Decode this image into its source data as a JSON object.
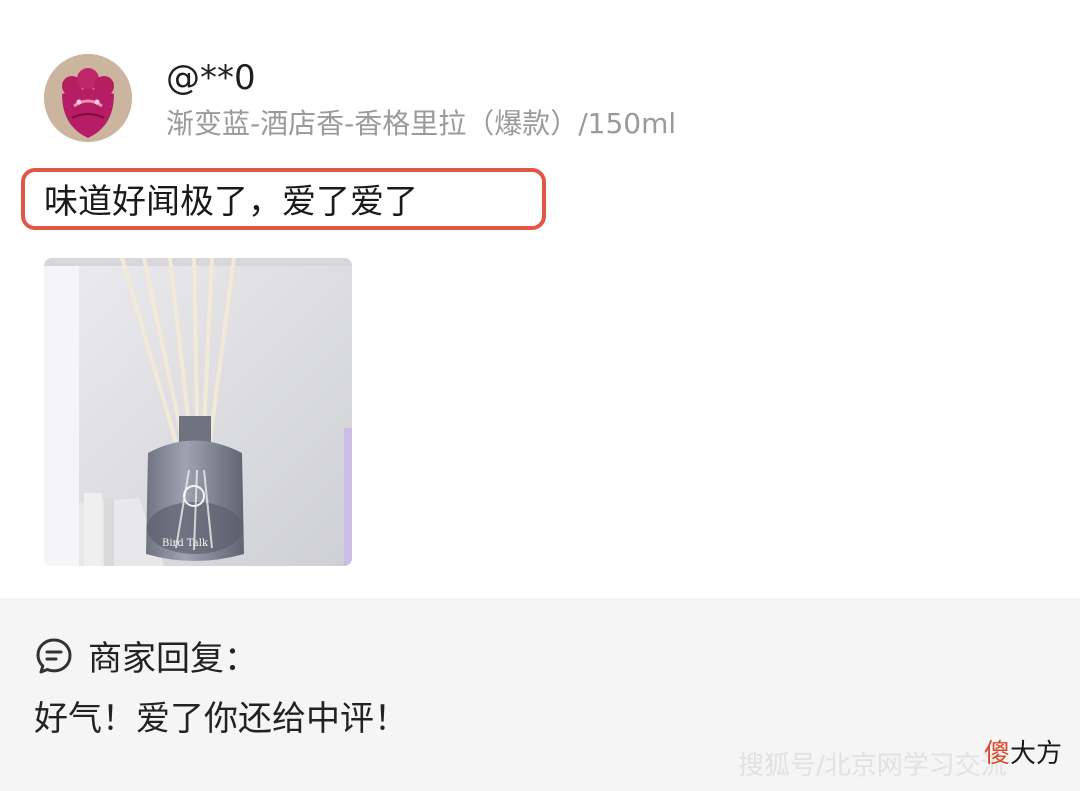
{
  "review": {
    "username": "@**0",
    "variant": "渐变蓝-酒店香-香格里拉（爆款）/150ml",
    "text": "味道好闻极了，爱了爱了",
    "avatar_icon": "cartoon-avatar-icon",
    "photo_label": "Bird Talk"
  },
  "merchant_reply": {
    "icon": "chat-bubble-icon",
    "title": "商家回复：",
    "text": "好气！爱了你还给中评！"
  },
  "watermark": {
    "text": "搜狐号/北京网学习交流"
  },
  "brand": {
    "accent": "傻",
    "rest": "大方"
  },
  "colors": {
    "highlight": "#e25643",
    "reply_background": "#f5f5f5",
    "secondary_text": "#9a9a9a"
  }
}
